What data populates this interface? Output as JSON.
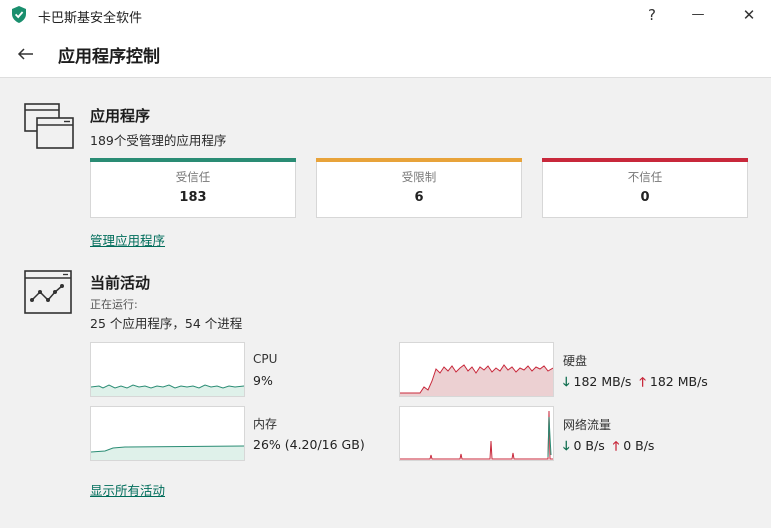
{
  "window": {
    "title": "卡巴斯基安全软件",
    "help_label": "?",
    "minimize_label": "—",
    "close_label": "✕"
  },
  "header": {
    "title": "应用程序控制"
  },
  "applications": {
    "title": "应用程序",
    "subtitle": "189个受管理的应用程序",
    "cards": [
      {
        "label": "受信任",
        "value": "183",
        "color": "#2a8c74"
      },
      {
        "label": "受限制",
        "value": "6",
        "color": "#e8a33a"
      },
      {
        "label": "不信任",
        "value": "0",
        "color": "#c8283b"
      }
    ],
    "manage_link": "管理应用程序"
  },
  "activity": {
    "title": "当前活动",
    "running_label": "正在运行:",
    "running_value": "25 个应用程序，54 个进程",
    "metrics": {
      "cpu": {
        "name": "CPU",
        "value": "9%"
      },
      "memory": {
        "name": "内存",
        "value": "26% (4.20/16 GB)"
      },
      "disk": {
        "name": "硬盘",
        "down_arrow": "🡓",
        "down": "182 MB/s",
        "up_arrow": "🡑",
        "up": "182 MB/s"
      },
      "network": {
        "name": "网络流量",
        "down_arrow": "🡓",
        "down": "0 B/s",
        "up_arrow": "🡑",
        "up": "0 B/s"
      }
    },
    "show_all_link": "显示所有活动"
  },
  "colors": {
    "accent_green": "#2a8c74",
    "graph_green_fill": "#dff1ea",
    "graph_red_line": "#c8283b",
    "graph_red_fill": "#ecd0d2",
    "link": "#006d5b"
  }
}
